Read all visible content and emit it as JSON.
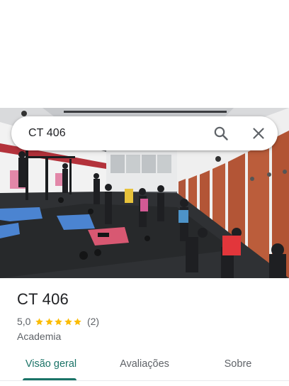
{
  "search": {
    "query": "CT 406"
  },
  "place": {
    "name": "CT 406",
    "rating": "5,0",
    "stars": 5,
    "review_count": "(2)",
    "category": "Academia"
  },
  "tabs": [
    {
      "label": "Visão geral",
      "active": true
    },
    {
      "label": "Avaliações",
      "active": false
    },
    {
      "label": "Sobre",
      "active": false
    }
  ],
  "colors": {
    "accent": "#1a7367",
    "star": "#fbbc04",
    "text_primary": "#202124",
    "text_secondary": "#5f6368"
  },
  "icons": {
    "search": "search-icon",
    "close": "close-icon"
  }
}
